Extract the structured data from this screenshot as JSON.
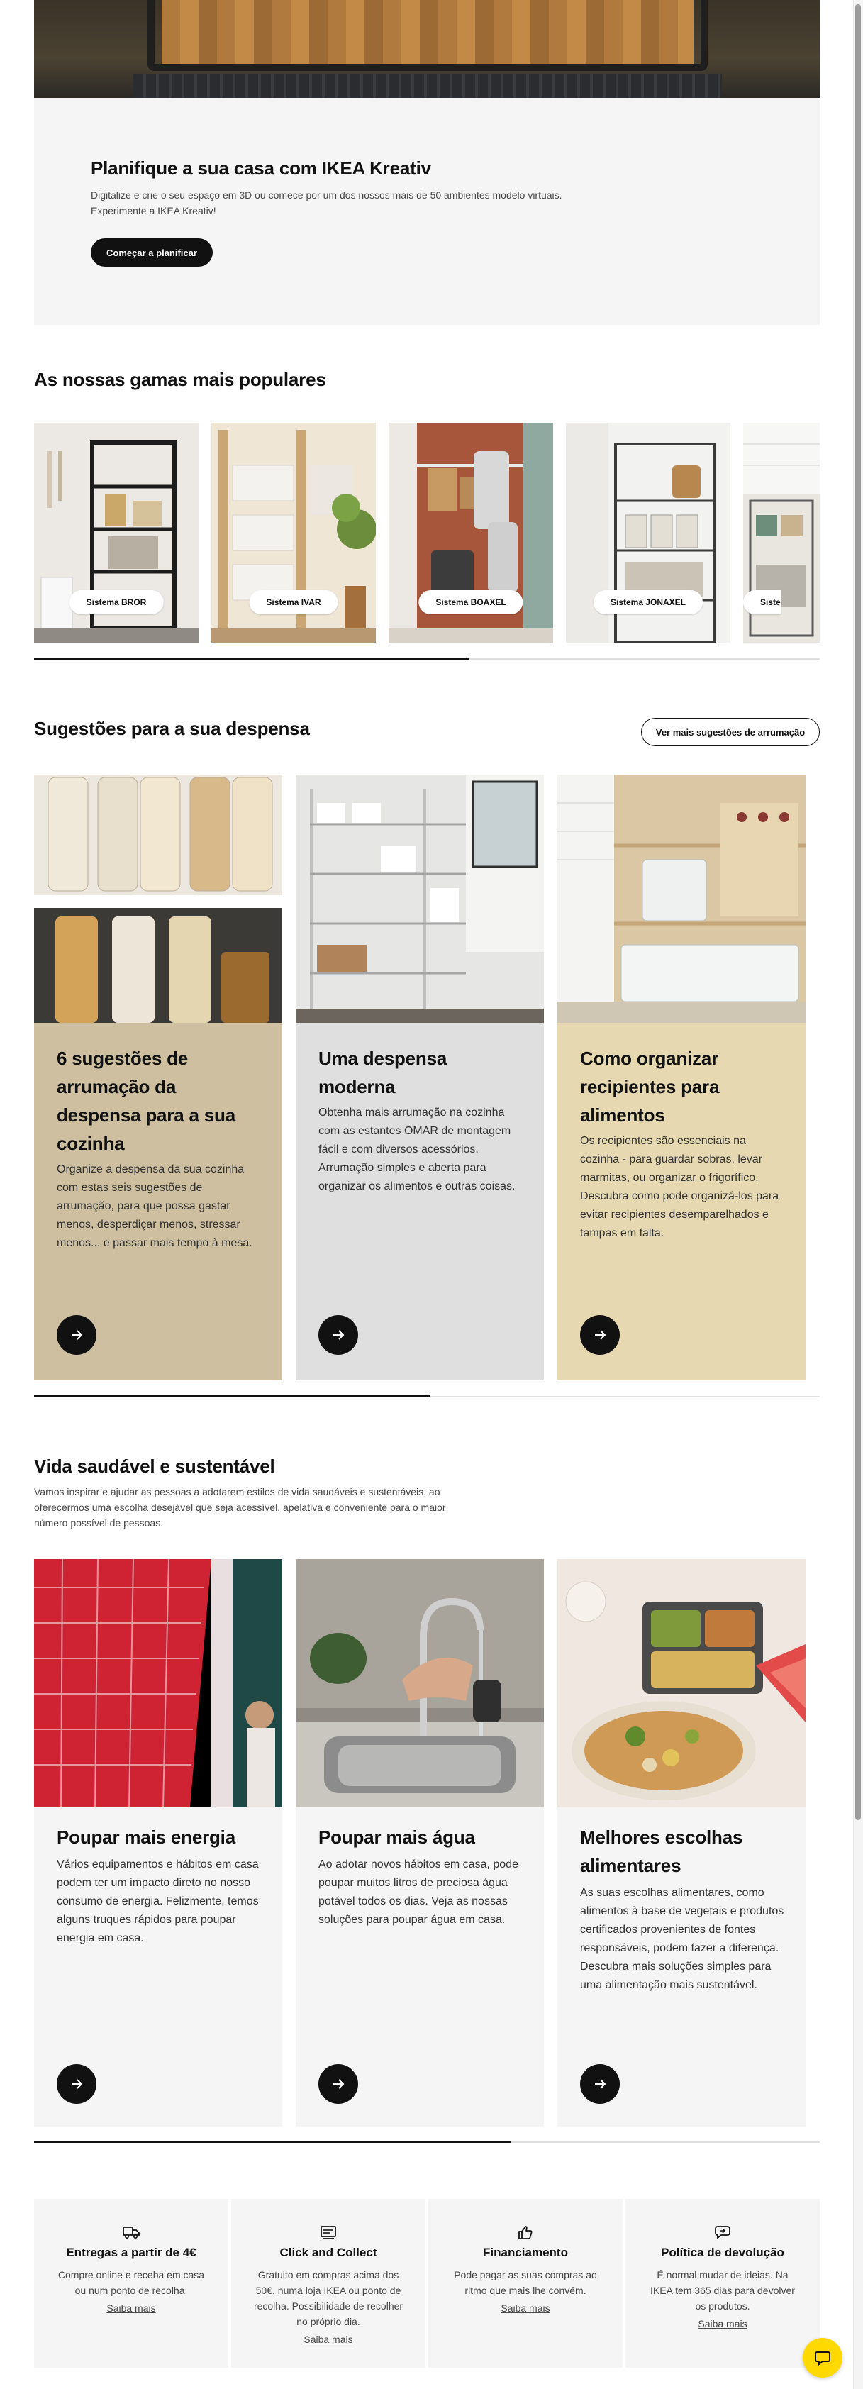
{
  "colors": {
    "dark": "#111111",
    "panel_grey": "#f5f5f5",
    "card_beige": "#cdbf9f",
    "card_grey": "#dfdfe0",
    "card_sand": "#e6d8b0",
    "chat_yellow": "#ffd900"
  },
  "kreativ": {
    "title": "Planifique a sua casa com IKEA Kreativ",
    "text": "Digitalize e crie o seu espaço em 3D ou comece por um dos nossos mais de 50 ambientes modelo virtuais. Experimente a IKEA Kreativ!",
    "button": "Começar a planificar"
  },
  "ranges": {
    "title": "As nossas gamas mais populares",
    "items": [
      {
        "label": "Sistema BROR"
      },
      {
        "label": "Sistema IVAR"
      },
      {
        "label": "Sistema BOAXEL"
      },
      {
        "label": "Sistema JONAXEL"
      },
      {
        "label": "Siste"
      }
    ]
  },
  "pantry": {
    "title": "Sugestões para a sua despensa",
    "more_button": "Ver mais sugestões de arrumação",
    "cards": [
      {
        "title": "6 sugestões de arrumação da despensa para a sua cozinha",
        "text": "Organize a despensa da sua cozinha com estas seis sugestões de arrumação, para que possa gastar menos, desperdiçar menos, stressar menos... e passar mais tempo à mesa."
      },
      {
        "title": "Uma despensa moderna",
        "text": "Obtenha mais arrumação na cozinha com as estantes OMAR de montagem fácil e com diversos acessórios. Arrumação simples e aberta para organizar os alimentos e outras coisas."
      },
      {
        "title": "Como organizar recipientes para alimentos",
        "text": "Os recipientes são essenciais na cozinha - para guardar sobras, levar marmitas, ou organizar o frigorífico. Descubra como pode organizá-los para evitar recipientes desemparelhados e tampas em falta."
      }
    ]
  },
  "healthy": {
    "title": "Vida saudável e sustentável",
    "text": "Vamos inspirar e ajudar as pessoas a adotarem estilos de vida saudáveis e sustentáveis, ao oferecermos uma escolha desejável que seja acessível, apelativa e conveniente para o maior número possível de pessoas.",
    "cards": [
      {
        "title": "Poupar mais energia",
        "text": "Vários equipamentos e hábitos em casa podem ter um impacto direto no nosso consumo de energia. Felizmente, temos alguns truques rápidos para poupar energia em casa."
      },
      {
        "title": "Poupar mais água",
        "text": "Ao adotar novos hábitos em casa, pode poupar muitos litros de preciosa água potável todos os dias. Veja as nossas soluções para poupar água em casa."
      },
      {
        "title": "Melhores escolhas alimentares",
        "text": "As suas escolhas alimentares, como alimentos à base de vegetais e produtos certificados provenientes de fontes responsáveis, podem fazer a diferença. Descubra mais soluções simples para uma alimentação mais sustentável."
      }
    ]
  },
  "services": [
    {
      "title": "Entregas a partir de 4€",
      "text": "Compre online e receba em casa ou num ponto de recolha.",
      "link": "Saiba mais",
      "icon": "truck-icon"
    },
    {
      "title": "Click and Collect",
      "text": "Gratuito em compras acima dos 50€, numa loja IKEA ou ponto de recolha. Possibilidade de recolher no próprio dia.",
      "link": "Saiba mais",
      "icon": "receipt-icon"
    },
    {
      "title": "Financiamento",
      "text": "Pode pagar as suas compras ao ritmo que mais lhe convém.",
      "link": "Saiba mais",
      "icon": "thumbs-up-icon"
    },
    {
      "title": "Política de devolução",
      "text": "É normal mudar de ideias. Na IKEA tem 365 dias para devolver os produtos.",
      "link": "Saiba mais",
      "icon": "return-chat-icon"
    }
  ]
}
